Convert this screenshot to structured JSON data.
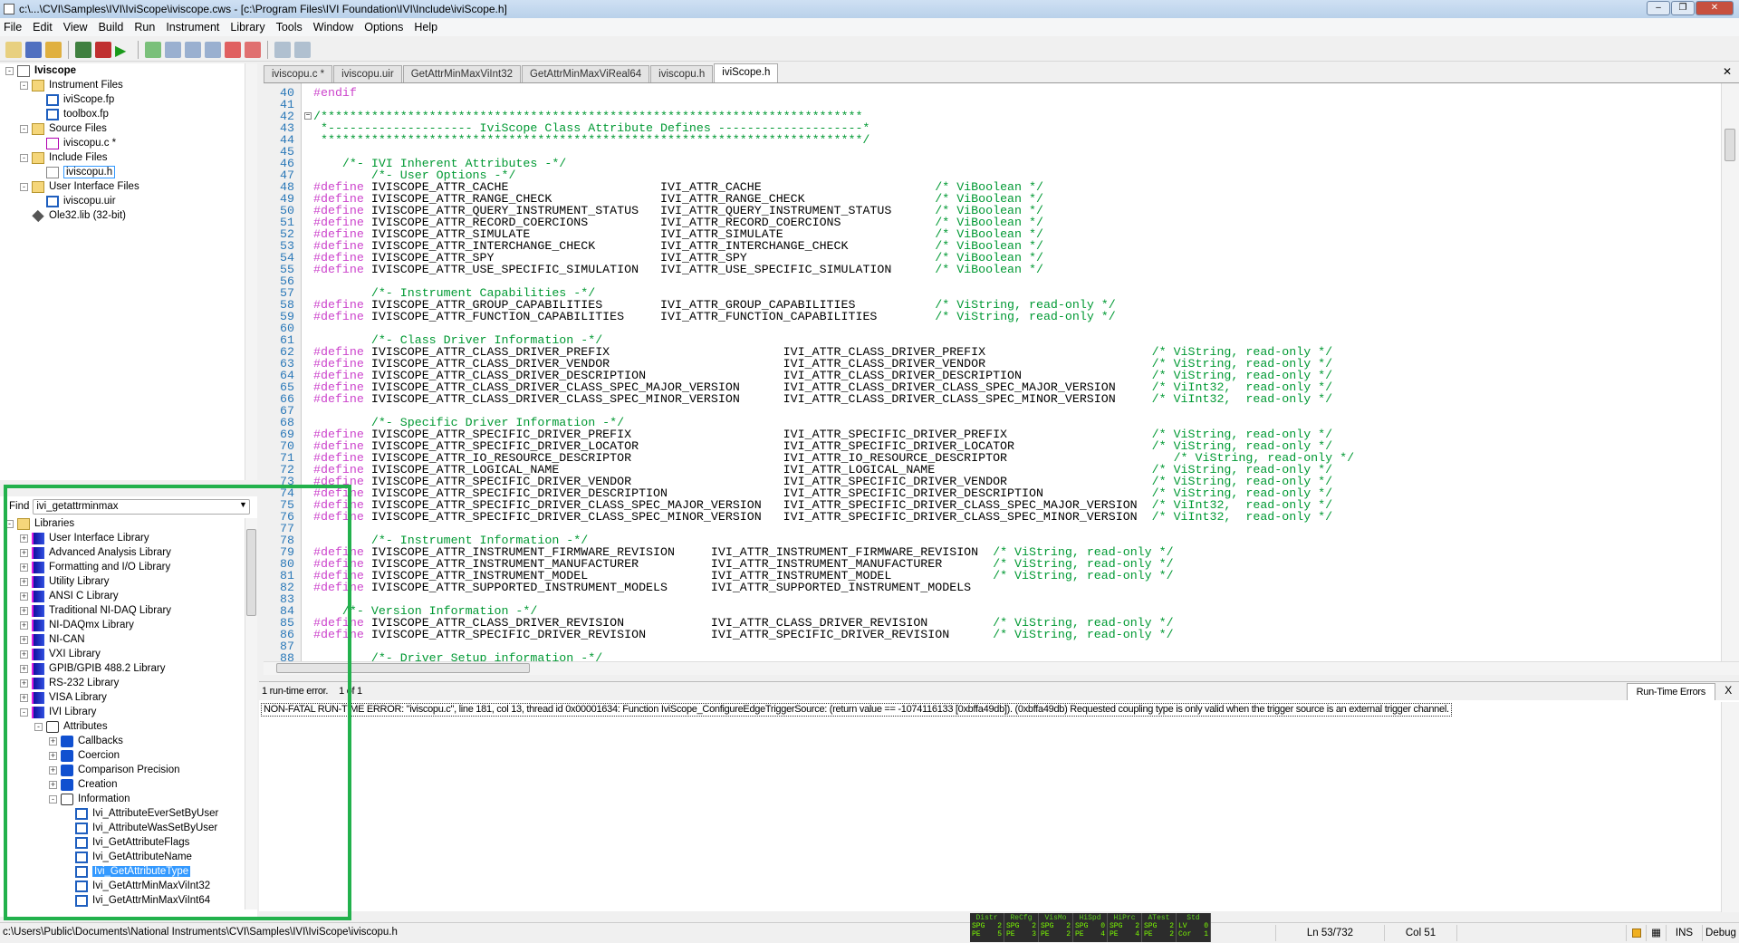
{
  "window": {
    "title": "c:\\...\\CVI\\Samples\\IVI\\IviScope\\iviscope.cws - [c:\\Program Files\\IVI Foundation\\IVI\\Include\\iviScope.h]",
    "controls": [
      "minimize",
      "restore",
      "close"
    ]
  },
  "menu": [
    "File",
    "Edit",
    "View",
    "Build",
    "Run",
    "Instrument",
    "Library",
    "Tools",
    "Window",
    "Options",
    "Help"
  ],
  "toolbar": [
    "new-c-file",
    "new-uir",
    "open",
    "function-tree",
    "debug",
    "run",
    "go",
    "step-over",
    "step-into",
    "step-out",
    "stop",
    "break",
    "toggle-a",
    "toggle-b"
  ],
  "workspace_tree": [
    {
      "level": 0,
      "exp": "-",
      "icon": "project",
      "label": "Iviscope",
      "bold": true
    },
    {
      "level": 1,
      "exp": "-",
      "icon": "folder",
      "label": "Instrument Files"
    },
    {
      "level": 2,
      "icon": "fp",
      "label": "iviScope.fp"
    },
    {
      "level": 2,
      "icon": "fp",
      "label": "toolbox.fp"
    },
    {
      "level": 1,
      "exp": "-",
      "icon": "folder",
      "label": "Source Files"
    },
    {
      "level": 2,
      "icon": "c-file",
      "label": "iviscopu.c *"
    },
    {
      "level": 1,
      "exp": "-",
      "icon": "folder",
      "label": "Include Files"
    },
    {
      "level": 2,
      "icon": "h-file",
      "label": "iviscopu.h",
      "boxed": true
    },
    {
      "level": 1,
      "exp": "-",
      "icon": "folder",
      "label": "User Interface Files"
    },
    {
      "level": 2,
      "icon": "uir",
      "label": "iviscopu.uir"
    },
    {
      "level": 1,
      "icon": "lib",
      "label": "Ole32.lib (32-bit)"
    }
  ],
  "find": {
    "label": "Find",
    "value": "ivi_getattrminmax"
  },
  "library_tree": [
    {
      "level": 0,
      "exp": "-",
      "icon": "folder",
      "label": "Libraries"
    },
    {
      "level": 1,
      "exp": "+",
      "icon": "library",
      "label": "User Interface Library"
    },
    {
      "level": 1,
      "exp": "+",
      "icon": "library",
      "label": "Advanced Analysis Library"
    },
    {
      "level": 1,
      "exp": "+",
      "icon": "library",
      "label": "Formatting and I/O Library"
    },
    {
      "level": 1,
      "exp": "+",
      "icon": "library",
      "label": "Utility Library"
    },
    {
      "level": 1,
      "exp": "+",
      "icon": "library",
      "label": "ANSI C Library"
    },
    {
      "level": 1,
      "exp": "+",
      "icon": "library",
      "label": "Traditional NI-DAQ Library"
    },
    {
      "level": 1,
      "exp": "+",
      "icon": "library",
      "label": "NI-DAQmx Library"
    },
    {
      "level": 1,
      "exp": "+",
      "icon": "library",
      "label": "NI-CAN"
    },
    {
      "level": 1,
      "exp": "+",
      "icon": "library",
      "label": "VXI Library"
    },
    {
      "level": 1,
      "exp": "+",
      "icon": "library",
      "label": "GPIB/GPIB 488.2 Library"
    },
    {
      "level": 1,
      "exp": "+",
      "icon": "library",
      "label": "RS-232 Library"
    },
    {
      "level": 1,
      "exp": "+",
      "icon": "library",
      "label": "VISA Library"
    },
    {
      "level": 1,
      "exp": "-",
      "icon": "library",
      "label": "IVI Library"
    },
    {
      "level": 2,
      "exp": "-",
      "icon": "open-book",
      "label": "Attributes"
    },
    {
      "level": 3,
      "exp": "+",
      "icon": "book",
      "label": "Callbacks"
    },
    {
      "level": 3,
      "exp": "+",
      "icon": "book",
      "label": "Coercion"
    },
    {
      "level": 3,
      "exp": "+",
      "icon": "book",
      "label": "Comparison Precision"
    },
    {
      "level": 3,
      "exp": "+",
      "icon": "book",
      "label": "Creation"
    },
    {
      "level": 3,
      "exp": "-",
      "icon": "open-book",
      "label": "Information"
    },
    {
      "level": 4,
      "icon": "fp",
      "label": "Ivi_AttributeEverSetByUser"
    },
    {
      "level": 4,
      "icon": "fp",
      "label": "Ivi_AttributeWasSetByUser"
    },
    {
      "level": 4,
      "icon": "fp",
      "label": "Ivi_GetAttributeFlags"
    },
    {
      "level": 4,
      "icon": "fp",
      "label": "Ivi_GetAttributeName"
    },
    {
      "level": 4,
      "icon": "fp",
      "label": "Ivi_GetAttributeType",
      "selected": true
    },
    {
      "level": 4,
      "icon": "fp",
      "label": "Ivi_GetAttrMinMaxViInt32"
    },
    {
      "level": 4,
      "icon": "fp",
      "label": "Ivi_GetAttrMinMaxViInt64"
    }
  ],
  "tabs": [
    {
      "label": "iviscopu.c *"
    },
    {
      "label": "iviscopu.uir"
    },
    {
      "label": "GetAttrMinMaxViInt32"
    },
    {
      "label": "GetAttrMinMaxViReal64"
    },
    {
      "label": "iviscopu.h"
    },
    {
      "label": "iviScope.h",
      "active": true
    }
  ],
  "code": [
    {
      "n": 40,
      "pp": "#endif"
    },
    {
      "n": 41
    },
    {
      "n": 42,
      "fold": true,
      "cm": "/***************************************************************************"
    },
    {
      "n": 43,
      "cm": " *-------------------- IviScope Class Attribute Defines --------------------*"
    },
    {
      "n": 44,
      "cm": " ***************************************************************************/"
    },
    {
      "n": 45
    },
    {
      "n": 46,
      "cm": "    /*- IVI Inherent Attributes -*/"
    },
    {
      "n": 47,
      "cm": "        /*- User Options -*/"
    },
    {
      "n": 48,
      "def": [
        "IVISCOPE_ATTR_CACHE",
        "IVI_ATTR_CACHE",
        "/* ViBoolean */"
      ]
    },
    {
      "n": 49,
      "def": [
        "IVISCOPE_ATTR_RANGE_CHECK",
        "IVI_ATTR_RANGE_CHECK",
        "/* ViBoolean */"
      ]
    },
    {
      "n": 50,
      "def": [
        "IVISCOPE_ATTR_QUERY_INSTRUMENT_STATUS",
        "IVI_ATTR_QUERY_INSTRUMENT_STATUS",
        "/* ViBoolean */"
      ]
    },
    {
      "n": 51,
      "def": [
        "IVISCOPE_ATTR_RECORD_COERCIONS",
        "IVI_ATTR_RECORD_COERCIONS",
        "/* ViBoolean */"
      ]
    },
    {
      "n": 52,
      "def": [
        "IVISCOPE_ATTR_SIMULATE",
        "IVI_ATTR_SIMULATE",
        "/* ViBoolean */"
      ]
    },
    {
      "n": 53,
      "def": [
        "IVISCOPE_ATTR_INTERCHANGE_CHECK",
        "IVI_ATTR_INTERCHANGE_CHECK",
        "/* ViBoolean */"
      ]
    },
    {
      "n": 54,
      "def": [
        "IVISCOPE_ATTR_SPY",
        "IVI_ATTR_SPY",
        "/* ViBoolean */"
      ]
    },
    {
      "n": 55,
      "def": [
        "IVISCOPE_ATTR_USE_SPECIFIC_SIMULATION",
        "IVI_ATTR_USE_SPECIFIC_SIMULATION",
        "/* ViBoolean */"
      ]
    },
    {
      "n": 56
    },
    {
      "n": 57,
      "cm": "        /*- Instrument Capabilities -*/"
    },
    {
      "n": 58,
      "def": [
        "IVISCOPE_ATTR_GROUP_CAPABILITIES",
        "IVI_ATTR_GROUP_CAPABILITIES",
        "/* ViString, read-only */"
      ]
    },
    {
      "n": 59,
      "def": [
        "IVISCOPE_ATTR_FUNCTION_CAPABILITIES",
        "IVI_ATTR_FUNCTION_CAPABILITIES",
        "/* ViString, read-only */"
      ]
    },
    {
      "n": 60
    },
    {
      "n": 61,
      "cm": "        /*- Class Driver Information -*/"
    },
    {
      "n": 62,
      "def": [
        "IVISCOPE_ATTR_CLASS_DRIVER_PREFIX",
        "IVI_ATTR_CLASS_DRIVER_PREFIX",
        "/* ViString, read-only */"
      ]
    },
    {
      "n": 63,
      "def": [
        "IVISCOPE_ATTR_CLASS_DRIVER_VENDOR",
        "IVI_ATTR_CLASS_DRIVER_VENDOR",
        "/* ViString, read-only */"
      ]
    },
    {
      "n": 64,
      "def": [
        "IVISCOPE_ATTR_CLASS_DRIVER_DESCRIPTION",
        "IVI_ATTR_CLASS_DRIVER_DESCRIPTION",
        "/* ViString, read-only */"
      ]
    },
    {
      "n": 65,
      "def": [
        "IVISCOPE_ATTR_CLASS_DRIVER_CLASS_SPEC_MAJOR_VERSION",
        "IVI_ATTR_CLASS_DRIVER_CLASS_SPEC_MAJOR_VERSION",
        "/* ViInt32,  read-only */"
      ]
    },
    {
      "n": 66,
      "def": [
        "IVISCOPE_ATTR_CLASS_DRIVER_CLASS_SPEC_MINOR_VERSION",
        "IVI_ATTR_CLASS_DRIVER_CLASS_SPEC_MINOR_VERSION",
        "/* ViInt32,  read-only */"
      ]
    },
    {
      "n": 67
    },
    {
      "n": 68,
      "cm": "        /*- Specific Driver Information -*/"
    },
    {
      "n": 69,
      "def": [
        "IVISCOPE_ATTR_SPECIFIC_DRIVER_PREFIX",
        "IVI_ATTR_SPECIFIC_DRIVER_PREFIX",
        "/* ViString, read-only */"
      ]
    },
    {
      "n": 70,
      "def": [
        "IVISCOPE_ATTR_SPECIFIC_DRIVER_LOCATOR",
        "IVI_ATTR_SPECIFIC_DRIVER_LOCATOR",
        "/* ViString, read-only */"
      ]
    },
    {
      "n": 71,
      "def": [
        "IVISCOPE_ATTR_IO_RESOURCE_DESCRIPTOR",
        "IVI_ATTR_IO_RESOURCE_DESCRIPTOR",
        "   /* ViString, read-only */"
      ]
    },
    {
      "n": 72,
      "def": [
        "IVISCOPE_ATTR_LOGICAL_NAME",
        "IVI_ATTR_LOGICAL_NAME",
        "/* ViString, read-only */"
      ]
    },
    {
      "n": 73,
      "def": [
        "IVISCOPE_ATTR_SPECIFIC_DRIVER_VENDOR",
        "IVI_ATTR_SPECIFIC_DRIVER_VENDOR",
        "/* ViString, read-only */"
      ]
    },
    {
      "n": 74,
      "def": [
        "IVISCOPE_ATTR_SPECIFIC_DRIVER_DESCRIPTION",
        "IVI_ATTR_SPECIFIC_DRIVER_DESCRIPTION",
        "/* ViString, read-only */"
      ]
    },
    {
      "n": 75,
      "def": [
        "IVISCOPE_ATTR_SPECIFIC_DRIVER_CLASS_SPEC_MAJOR_VERSION",
        "IVI_ATTR_SPECIFIC_DRIVER_CLASS_SPEC_MAJOR_VERSION",
        "/* ViInt32,  read-only */"
      ]
    },
    {
      "n": 76,
      "def": [
        "IVISCOPE_ATTR_SPECIFIC_DRIVER_CLASS_SPEC_MINOR_VERSION",
        "IVI_ATTR_SPECIFIC_DRIVER_CLASS_SPEC_MINOR_VERSION",
        "/* ViInt32,  read-only */"
      ]
    },
    {
      "n": 77
    },
    {
      "n": 78,
      "cm": "        /*- Instrument Information -*/"
    },
    {
      "n": 79,
      "def": [
        "IVISCOPE_ATTR_INSTRUMENT_FIRMWARE_REVISION",
        "IVI_ATTR_INSTRUMENT_FIRMWARE_REVISION",
        "/* ViString, read-only */"
      ]
    },
    {
      "n": 80,
      "def": [
        "IVISCOPE_ATTR_INSTRUMENT_MANUFACTURER",
        "IVI_ATTR_INSTRUMENT_MANUFACTURER",
        "/* ViString, read-only */"
      ]
    },
    {
      "n": 81,
      "def": [
        "IVISCOPE_ATTR_INSTRUMENT_MODEL",
        "IVI_ATTR_INSTRUMENT_MODEL",
        "/* ViString, read-only */"
      ]
    },
    {
      "n": 82,
      "def": [
        "IVISCOPE_ATTR_SUPPORTED_INSTRUMENT_MODELS",
        "IVI_ATTR_SUPPORTED_INSTRUMENT_MODELS",
        ""
      ]
    },
    {
      "n": 83
    },
    {
      "n": 84,
      "cm": "    /*- Version Information -*/"
    },
    {
      "n": 85,
      "def": [
        "IVISCOPE_ATTR_CLASS_DRIVER_REVISION",
        "IVI_ATTR_CLASS_DRIVER_REVISION",
        "/* ViString, read-only */"
      ]
    },
    {
      "n": 86,
      "def": [
        "IVISCOPE_ATTR_SPECIFIC_DRIVER_REVISION",
        "IVI_ATTR_SPECIFIC_DRIVER_REVISION",
        "/* ViString, read-only */"
      ]
    },
    {
      "n": 87
    },
    {
      "n": 88,
      "cm": "        /*- Driver Setup information -*/"
    }
  ],
  "define_keyword": "#define",
  "errors": {
    "summary": "1 run-time error.",
    "position": "1 of 1",
    "tab": "Run-Time Errors",
    "close": "X",
    "message": "NON-FATAL RUN-TIME ERROR:   \"iviscopu.c\", line 181, col 13, thread id 0x00001634:   Function IviScope_ConfigureEdgeTriggerSource: (return value == -1074116133 [0xbffa49db]). (0xbffa49db) Requested coupling type is only valid when the trigger source is an external trigger channel."
  },
  "status": {
    "path": "c:\\Users\\Public\\Documents\\National Instruments\\CVI\\Samples\\IVI\\IviScope\\iviscopu.h",
    "line": "Ln 53/732",
    "col": "Col 51",
    "ins": "INS",
    "config": "Debug"
  },
  "meters": [
    {
      "name": "Distr",
      "r1": [
        "SPG",
        "2"
      ],
      "r2": [
        "PE",
        "5"
      ]
    },
    {
      "name": "ReCfg",
      "r1": [
        "SPG",
        "2"
      ],
      "r2": [
        "PE",
        "3"
      ]
    },
    {
      "name": "VisMo",
      "r1": [
        "SPG",
        "2"
      ],
      "r2": [
        "PE",
        "2"
      ]
    },
    {
      "name": "HiSpd",
      "r1": [
        "SPG",
        "0"
      ],
      "r2": [
        "PE",
        "4"
      ]
    },
    {
      "name": "HiPrc",
      "r1": [
        "SPG",
        "2"
      ],
      "r2": [
        "PE",
        "4"
      ]
    },
    {
      "name": "ATest",
      "r1": [
        "SPG",
        "2"
      ],
      "r2": [
        "PE",
        "2"
      ]
    },
    {
      "name": "Std",
      "r1": [
        "LV",
        "0"
      ],
      "r2": [
        "Cor",
        "1"
      ]
    }
  ],
  "colors": {
    "highlight": "#22b14c",
    "preprocessor": "#cc44cc",
    "comment": "#009933",
    "line_number": "#2a78b8",
    "selection": "#3399ff"
  }
}
